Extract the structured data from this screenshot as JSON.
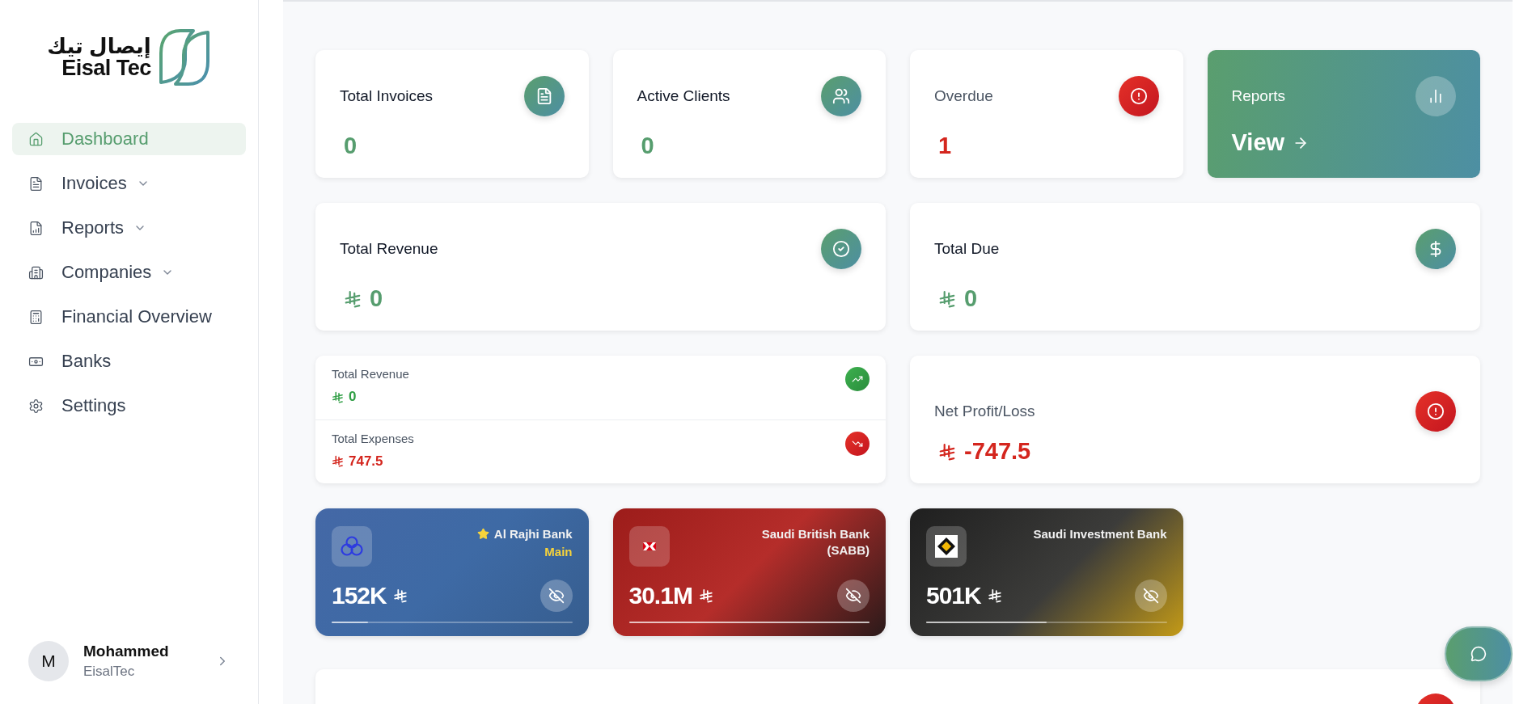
{
  "logo": {
    "arabic": "إيصال تيك",
    "latin": "Eisal Tec"
  },
  "sidebar": {
    "items": [
      {
        "label": "Dashboard",
        "selected": true,
        "expandable": false
      },
      {
        "label": "Invoices",
        "selected": false,
        "expandable": true
      },
      {
        "label": "Reports",
        "selected": false,
        "expandable": true
      },
      {
        "label": "Companies",
        "selected": false,
        "expandable": true
      },
      {
        "label": "Financial Overview",
        "selected": false,
        "expandable": false
      },
      {
        "label": "Banks",
        "selected": false,
        "expandable": false
      },
      {
        "label": "Settings",
        "selected": false,
        "expandable": false
      }
    ]
  },
  "user": {
    "initial": "M",
    "name": "Mohammed",
    "company": "EisalTec"
  },
  "stats": [
    {
      "kind": "stat",
      "label": "Total Invoices",
      "value": "0",
      "negative": false
    },
    {
      "kind": "stat",
      "label": "Active Clients",
      "value": "0",
      "negative": false
    },
    {
      "kind": "stat",
      "label": "Overdue",
      "value": "1",
      "negative": true
    },
    {
      "kind": "link",
      "label": "Reports",
      "value": "View"
    }
  ],
  "totals": [
    {
      "label": "Total Revenue",
      "value": "0"
    },
    {
      "label": "Total Due",
      "value": "0"
    }
  ],
  "cashflow": [
    {
      "label": "Total Revenue",
      "value": "0",
      "rising": true
    },
    {
      "label": "Total Expenses",
      "value": "747.5",
      "rising": false
    }
  ],
  "net": {
    "label": "Net Profit/Loss",
    "value": "-747.5",
    "negative": true
  },
  "banks": [
    {
      "name": "Al Rajhi Bank",
      "main": true,
      "badge": "Main",
      "balance": "152K",
      "level": 0.15,
      "kind": "blue"
    },
    {
      "name": "Saudi British Bank (SABB)",
      "main": false,
      "balance": "30.1M",
      "level": 1,
      "kind": "red"
    },
    {
      "name": "Saudi Investment Bank",
      "main": false,
      "balance": "501K",
      "level": 0.5,
      "kind": "dark"
    }
  ]
}
